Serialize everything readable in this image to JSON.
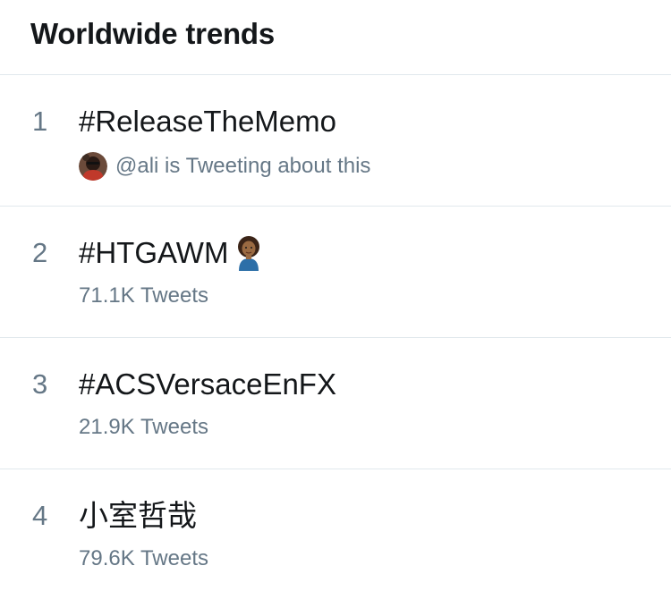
{
  "header": {
    "title": "Worldwide trends"
  },
  "trends": [
    {
      "rank": "1",
      "name": "#ReleaseTheMemo",
      "meta": "@ali is Tweeting about this",
      "avatar": "user-avatar"
    },
    {
      "rank": "2",
      "name": "#HTGAWM",
      "meta": "71.1K Tweets",
      "emoji": "woman-emoji-icon"
    },
    {
      "rank": "3",
      "name": "#ACSVersaceEnFX",
      "meta": "21.9K Tweets"
    },
    {
      "rank": "4",
      "name": "小室哲哉",
      "meta": "79.6K Tweets"
    }
  ],
  "colors": {
    "primary_text": "#14171a",
    "secondary_text": "#657786",
    "divider": "#e1e8ed"
  }
}
